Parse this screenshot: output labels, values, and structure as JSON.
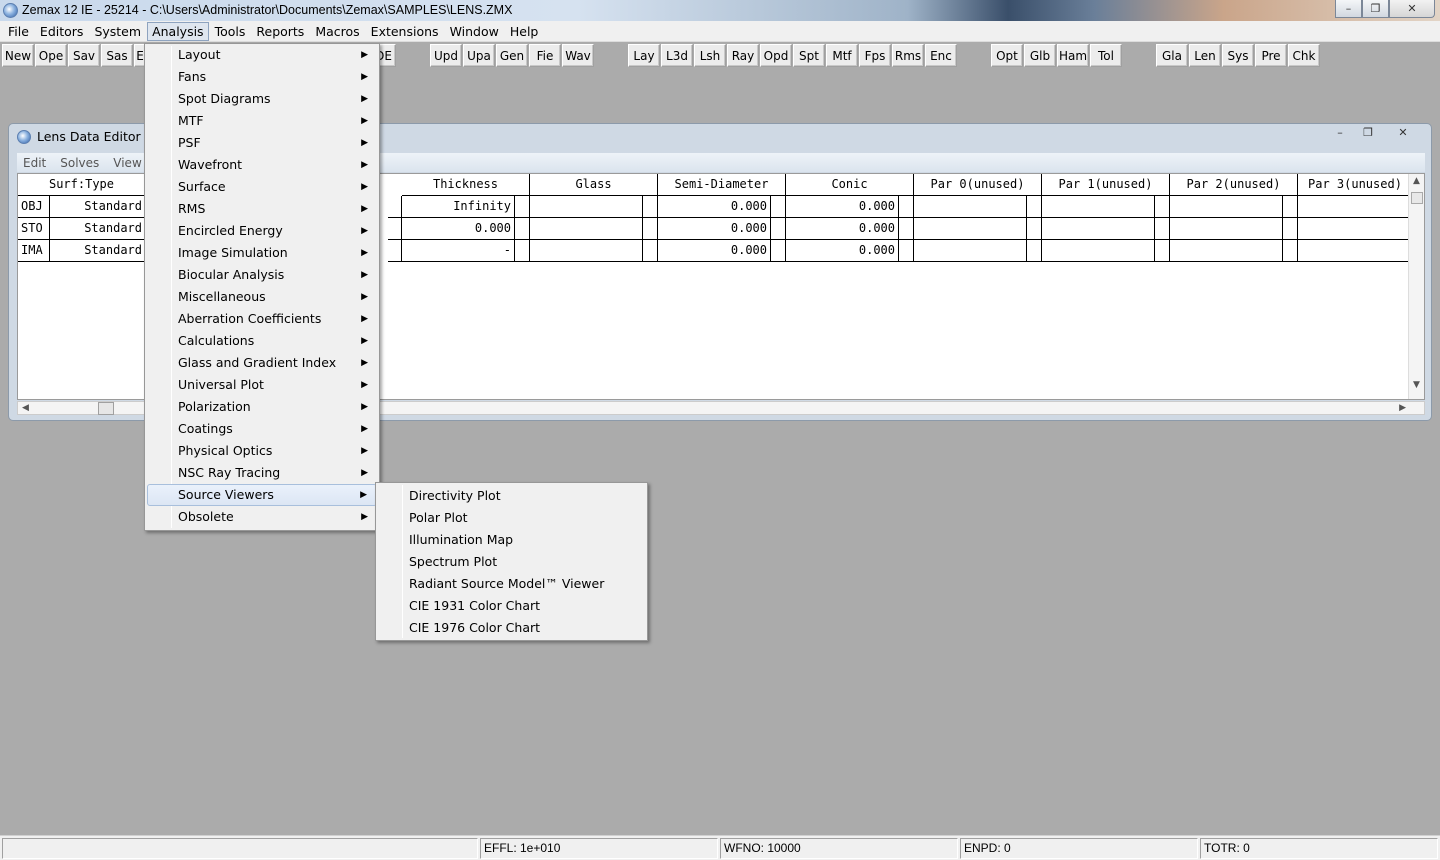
{
  "window": {
    "title": "Zemax 12 IE - 25214 - C:\\Users\\Administrator\\Documents\\Zemax\\SAMPLES\\LENS.ZMX",
    "controls": [
      "–",
      "❐",
      "✕"
    ]
  },
  "menubar": [
    "File",
    "Editors",
    "System",
    "Analysis",
    "Tools",
    "Reports",
    "Macros",
    "Extensions",
    "Window",
    "Help"
  ],
  "toolbar": {
    "g1": [
      "New",
      "Ope",
      "Sav",
      "Sas",
      "E"
    ],
    "g1b": [
      "DE"
    ],
    "g2": [
      "Upd",
      "Upa",
      "Gen",
      "Fie",
      "Wav"
    ],
    "g3": [
      "Lay",
      "L3d",
      "Lsh",
      "Ray",
      "Opd",
      "Spt",
      "Mtf",
      "Fps",
      "Rms",
      "Enc"
    ],
    "g4": [
      "Opt",
      "Glb",
      "Ham",
      "Tol"
    ],
    "g5": [
      "Gla",
      "Len",
      "Sys",
      "Pre",
      "Chk"
    ]
  },
  "editor": {
    "title": "Lens Data Editor",
    "menu": [
      "Edit",
      "Solves",
      "View"
    ],
    "columns": [
      "Surf:Type",
      "Thickness",
      "Glass",
      "Semi-Diameter",
      "Conic",
      "Par 0(unused)",
      "Par 1(unused)",
      "Par 2(unused)",
      "Par 3(unused)"
    ],
    "rows": [
      {
        "surf": "OBJ",
        "type": "Standard",
        "thickness": "Infinity",
        "semi": "0.000",
        "conic": "0.000"
      },
      {
        "surf": "STO",
        "type": "Standard",
        "thickness": "0.000",
        "semi": "0.000",
        "conic": "0.000"
      },
      {
        "surf": "IMA",
        "type": "Standard",
        "thickness": "-",
        "semi": "0.000",
        "conic": "0.000"
      }
    ]
  },
  "analysis_menu": {
    "items": [
      "Layout",
      "Fans",
      "Spot Diagrams",
      "MTF",
      "PSF",
      "Wavefront",
      "Surface",
      "RMS",
      "Encircled Energy",
      "Image Simulation",
      "Biocular Analysis",
      "Miscellaneous",
      "Aberration Coefficients",
      "Calculations",
      "Glass and Gradient Index",
      "Universal Plot",
      "Polarization",
      "Coatings",
      "Physical Optics",
      "NSC Ray Tracing",
      "Source Viewers",
      "Obsolete"
    ],
    "highlighted": "Source Viewers"
  },
  "source_viewers_submenu": [
    "Directivity Plot",
    "Polar Plot",
    "Illumination Map",
    "Spectrum Plot",
    "Radiant Source Model™ Viewer",
    "CIE 1931 Color Chart",
    "CIE 1976 Color Chart"
  ],
  "status": {
    "effl": "EFFL: 1e+010",
    "wfno": "WFNO: 10000",
    "enpd": "ENPD: 0",
    "totr": "TOTR: 0"
  }
}
